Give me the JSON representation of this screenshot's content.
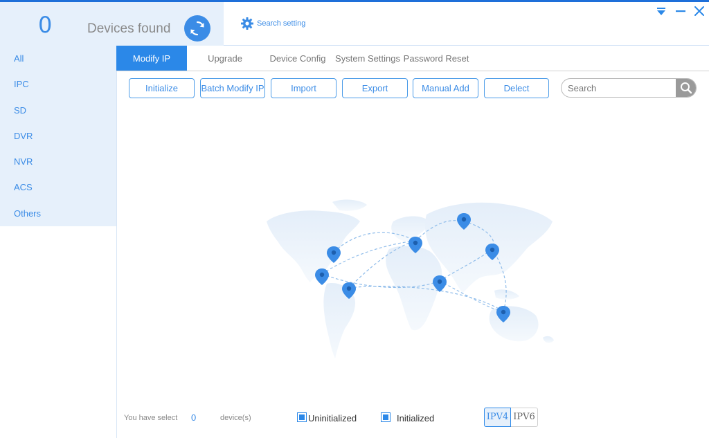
{
  "header": {
    "device_count": "0",
    "devices_found_label": "Devices found",
    "search_setting_label": "Search setting"
  },
  "window_controls": {
    "dropdown_icon": "dropdown-triangle-icon",
    "minimize_icon": "minimize-icon",
    "close_icon": "close-icon"
  },
  "sidebar": {
    "items": [
      {
        "label": "All"
      },
      {
        "label": "IPC"
      },
      {
        "label": "SD"
      },
      {
        "label": "DVR"
      },
      {
        "label": "NVR"
      },
      {
        "label": "ACS"
      },
      {
        "label": "Others"
      }
    ]
  },
  "tabs": [
    {
      "label": "Modify IP",
      "active": true
    },
    {
      "label": "Upgrade",
      "active": false
    },
    {
      "label": "Device Config",
      "active": false
    },
    {
      "label": "System Settings",
      "active": false
    },
    {
      "label": "Password Reset",
      "active": false
    }
  ],
  "toolbar": {
    "initialize": "Initialize",
    "batch_modify_ip": "Batch Modify IP",
    "import": "Import",
    "export": "Export",
    "manual_add": "Manual Add",
    "delect": "Delect"
  },
  "search": {
    "placeholder": "Search",
    "value": ""
  },
  "footer": {
    "you_have_select": "You have select",
    "selected_count": "0",
    "devices_label": "device(s)",
    "uninitialized_label": "Uninitialized",
    "initialized_label": "Initialized",
    "ipv4_label": "IPV4",
    "ipv6_label": "IPV6",
    "ip_version_selected": "IPV4"
  },
  "colors": {
    "accent": "#2b88e8",
    "sidebar_bg": "#e6f0fb",
    "map_fill": "#e8f1fb",
    "pin": "#3b8ce6"
  }
}
